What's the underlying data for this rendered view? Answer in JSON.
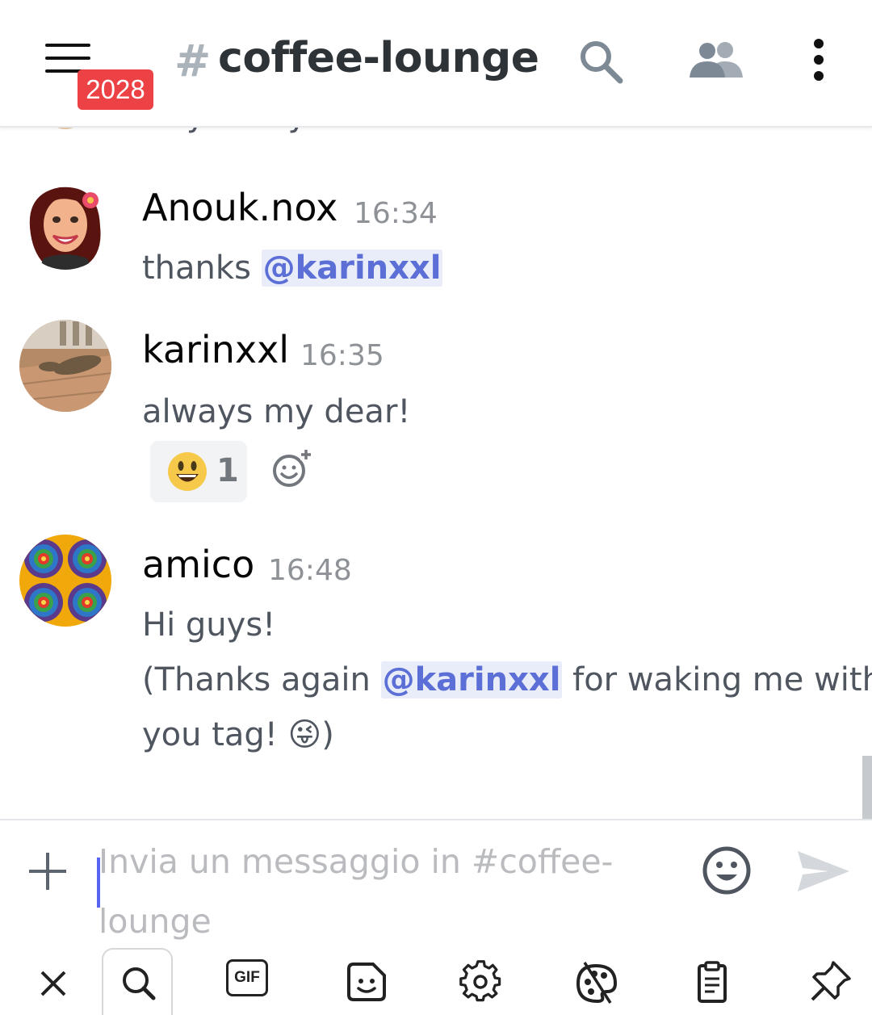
{
  "header": {
    "badge": "2028",
    "hash": "#",
    "channel": "coffee-lounge"
  },
  "partial_message": {
    "text": "Hey everyone"
  },
  "messages": [
    {
      "author": "Anouk.nox",
      "time": "16:34",
      "lines": [
        {
          "before": "thanks ",
          "mention": "@karinxxl",
          "after": ""
        }
      ]
    },
    {
      "author": "karinxxl",
      "time": "16:35",
      "text": "always my dear!",
      "reaction": {
        "emoji": "😃",
        "count": "1"
      }
    },
    {
      "author": "amico",
      "time": "16:48",
      "line1": "Hi guys!",
      "line2_before": "(Thanks again ",
      "line2_mention": "@karinxxl",
      "line2_after": " for waking me with",
      "line3_before": "you tag! ",
      "line3_emoji": "😜",
      "line3_after": ")"
    }
  ],
  "composer": {
    "placeholder": "Invia un messaggio in #coffee-lounge"
  },
  "keyboard_toolbar": {
    "gif_label": "GIF"
  },
  "colors": {
    "badge": "#ed4245",
    "mention_bg": "#e9ecf9",
    "mention_text": "#5b6fd6",
    "accent": "#5865f2"
  }
}
